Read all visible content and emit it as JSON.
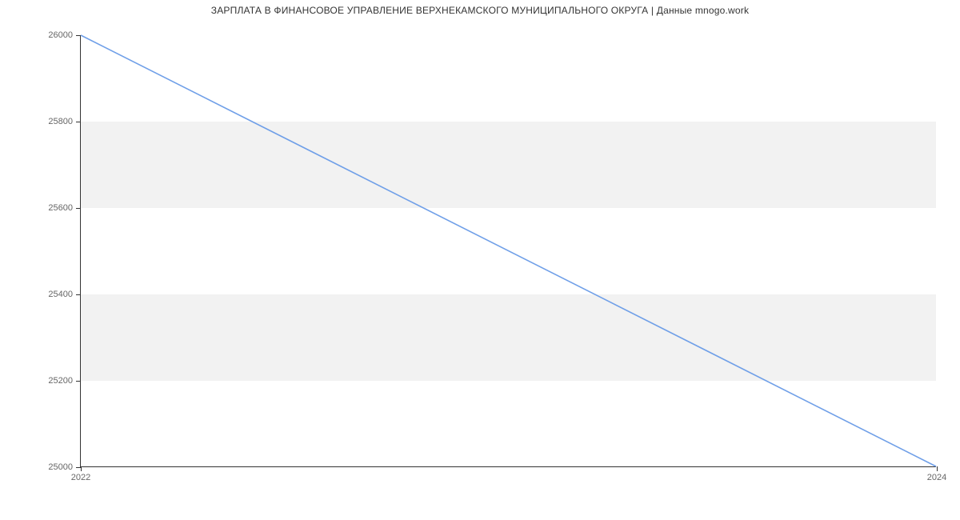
{
  "chart_data": {
    "type": "line",
    "title": "ЗАРПЛАТА В ФИНАНСОВОЕ УПРАВЛЕНИЕ ВЕРХНЕКАМСКОГО МУНИЦИПАЛЬНОГО ОКРУГА | Данные mnogo.work",
    "xlabel": "",
    "ylabel": "",
    "x": [
      2022,
      2024
    ],
    "series": [
      {
        "name": "salary",
        "values": [
          26000,
          25000
        ],
        "color": "#6f9fe8"
      }
    ],
    "xlim": [
      2022,
      2024
    ],
    "ylim": [
      25000,
      26000
    ],
    "y_ticks": [
      25000,
      25200,
      25400,
      25600,
      25800,
      26000
    ],
    "x_ticks": [
      2022,
      2024
    ],
    "bands": [
      {
        "from": 25200,
        "to": 25400
      },
      {
        "from": 25600,
        "to": 25800
      }
    ]
  }
}
